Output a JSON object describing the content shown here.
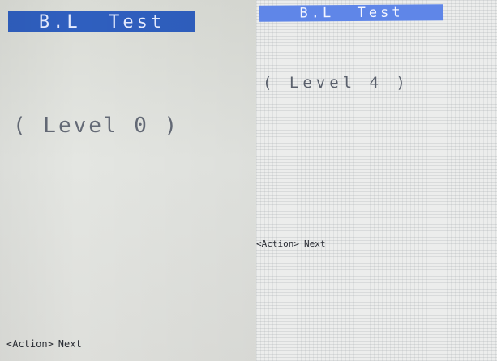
{
  "screens": [
    {
      "title": "B.L  Test",
      "level_text": "( Level 0 )",
      "footer_action": "<Action>",
      "footer_label": "Next"
    },
    {
      "title": "B.L  Test",
      "level_text": "( Level 4 )",
      "footer_action": "<Action>",
      "footer_label": "Next"
    }
  ],
  "colors": {
    "title_bar_left": "#2f5fbf",
    "title_bar_right": "#5f86e8",
    "screen_background": "#e4e6e2"
  }
}
